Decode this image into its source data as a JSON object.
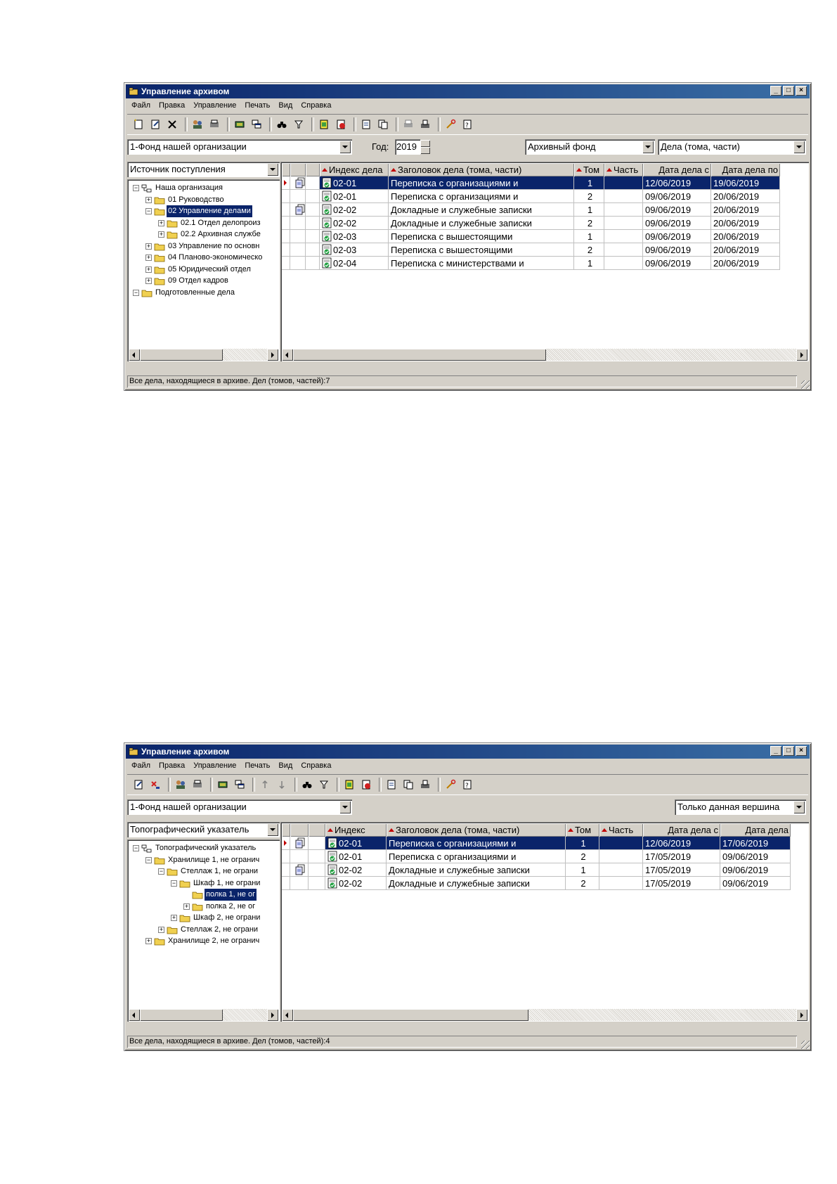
{
  "window1": {
    "title": "Управление архивом",
    "menu": [
      "Файл",
      "Правка",
      "Управление",
      "Печать",
      "Вид",
      "Справка"
    ],
    "fund_combo": "1-Фонд нашей организации",
    "year_label": "Год:",
    "year_value": "2019",
    "fund_type_combo": "Архивный фонд",
    "cases_combo": "Дела (тома, части)",
    "tree_combo": "Источник поступления",
    "tree": [
      {
        "label": "Наша организация",
        "toggle": "−"
      },
      {
        "label": "01 Руководство",
        "toggle": "+"
      },
      {
        "label": "02 Управление делами",
        "toggle": "−"
      },
      {
        "label": "02.1 Отдел делопроиз",
        "toggle": "+"
      },
      {
        "label": "02.2 Архивная службе",
        "toggle": "+"
      },
      {
        "label": "03 Управление по основн",
        "toggle": "+"
      },
      {
        "label": "04 Планово-экономическо",
        "toggle": "+"
      },
      {
        "label": "05 Юридический отдел",
        "toggle": "+"
      },
      {
        "label": "09 Отдел кадров",
        "toggle": "+"
      },
      {
        "label": "Подготовленные дела",
        "toggle": "−"
      }
    ],
    "headers": [
      "Индекс дела",
      "Заголовок дела (тома, части)",
      "Том",
      "Часть",
      "Дата дела с",
      "Дата дела по"
    ],
    "rows": [
      {
        "index": "02-01",
        "title": "Переписка с организациями и",
        "tom": "1",
        "part": "",
        "from": "12/06/2019",
        "to": "19/06/2019"
      },
      {
        "index": "02-01",
        "title": "Переписка с организациями и",
        "tom": "2",
        "part": "",
        "from": "09/06/2019",
        "to": "20/06/2019"
      },
      {
        "index": "02-02",
        "title": "Докладные и служебные записки",
        "tom": "1",
        "part": "",
        "from": "09/06/2019",
        "to": "20/06/2019"
      },
      {
        "index": "02-02",
        "title": "Докладные и служебные записки",
        "tom": "2",
        "part": "",
        "from": "09/06/2019",
        "to": "20/06/2019"
      },
      {
        "index": "02-03",
        "title": "Переписка с вышестоящими",
        "tom": "1",
        "part": "",
        "from": "09/06/2019",
        "to": "20/06/2019"
      },
      {
        "index": "02-03",
        "title": "Переписка с вышестоящими",
        "tom": "2",
        "part": "",
        "from": "09/06/2019",
        "to": "20/06/2019"
      },
      {
        "index": "02-04",
        "title": "Переписка с министерствами и",
        "tom": "1",
        "part": "",
        "from": "09/06/2019",
        "to": "20/06/2019"
      }
    ],
    "status": "Все дела, находящиеся в архиве. Дел (томов, частей):7"
  },
  "window2": {
    "title": "Управление архивом",
    "menu": [
      "Файл",
      "Правка",
      "Управление",
      "Печать",
      "Вид",
      "Справка"
    ],
    "fund_combo": "1-Фонд нашей организации",
    "scope_combo": "Только данная вершина",
    "tree_combo": "Топографический указатель",
    "tree": [
      {
        "label": "Топографический указатель",
        "toggle": "−"
      },
      {
        "label": "Хранилище 1, не огранич",
        "toggle": "−"
      },
      {
        "label": "Стеллаж 1, не ограни",
        "toggle": "−"
      },
      {
        "label": "Шкаф 1, не ограни",
        "toggle": "−"
      },
      {
        "label": "полка 1, не ог",
        "toggle": ""
      },
      {
        "label": "полка 2, не ог",
        "toggle": "+"
      },
      {
        "label": "Шкаф 2, не ограни",
        "toggle": "+"
      },
      {
        "label": "Стеллаж 2, не ограни",
        "toggle": "+"
      },
      {
        "label": "Хранилище 2, не огранич",
        "toggle": "+"
      }
    ],
    "headers": [
      "Индекс",
      "Заголовок дела (тома, части)",
      "Том",
      "Часть",
      "Дата дела с",
      "Дата дела"
    ],
    "rows": [
      {
        "index": "02-01",
        "title": "Переписка с организациями и",
        "tom": "1",
        "part": "",
        "from": "12/06/2019",
        "to": "17/06/2019"
      },
      {
        "index": "02-01",
        "title": "Переписка с организациями и",
        "tom": "2",
        "part": "",
        "from": "17/05/2019",
        "to": "09/06/2019"
      },
      {
        "index": "02-02",
        "title": "Докладные и служебные записки",
        "tom": "1",
        "part": "",
        "from": "17/05/2019",
        "to": "09/06/2019"
      },
      {
        "index": "02-02",
        "title": "Докладные и служебные записки",
        "tom": "2",
        "part": "",
        "from": "17/05/2019",
        "to": "09/06/2019"
      }
    ],
    "status": "Все дела, находящиеся в архиве. Дел (томов, частей):4"
  },
  "colors": {
    "title_start": "#0a246a",
    "title_end": "#3a6ea5",
    "face": "#d4d0c8",
    "selection": "#0a246a",
    "sort_marker": "#c00000"
  }
}
